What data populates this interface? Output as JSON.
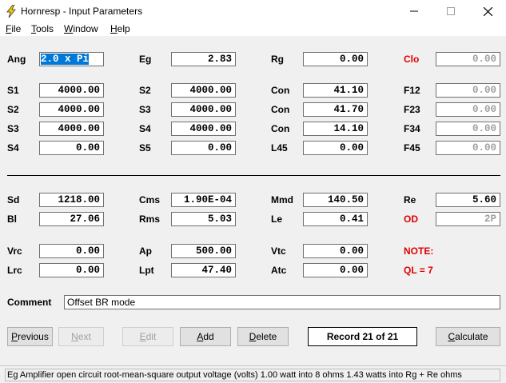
{
  "window": {
    "title": "Hornresp - Input Parameters"
  },
  "menu": [
    {
      "key": "F",
      "rest": "ile"
    },
    {
      "key": "T",
      "rest": "ools"
    },
    {
      "key": "W",
      "rest": "indow"
    },
    {
      "key": "H",
      "rest": "elp"
    }
  ],
  "params": {
    "Ang": {
      "label": "Ang",
      "value": "2.0 x Pi"
    },
    "Eg": {
      "label": "Eg",
      "value": "2.83"
    },
    "Rg": {
      "label": "Rg",
      "value": "0.00"
    },
    "Clo": {
      "label": "Clo",
      "value": "0.00"
    },
    "S1": {
      "label": "S1",
      "value": "4000.00"
    },
    "S2": {
      "label": "S2",
      "value": "4000.00"
    },
    "Con1": {
      "label": "Con",
      "value": "41.10"
    },
    "F12": {
      "label": "F12",
      "value": "0.00"
    },
    "S2b": {
      "label": "S2",
      "value": "4000.00"
    },
    "S3": {
      "label": "S3",
      "value": "4000.00"
    },
    "Con2": {
      "label": "Con",
      "value": "41.70"
    },
    "F23": {
      "label": "F23",
      "value": "0.00"
    },
    "S3b": {
      "label": "S3",
      "value": "4000.00"
    },
    "S4": {
      "label": "S4",
      "value": "4000.00"
    },
    "Con3": {
      "label": "Con",
      "value": "14.10"
    },
    "F34": {
      "label": "F34",
      "value": "0.00"
    },
    "S4b": {
      "label": "S4",
      "value": "0.00"
    },
    "S5": {
      "label": "S5",
      "value": "0.00"
    },
    "L45": {
      "label": "L45",
      "value": "0.00"
    },
    "F45": {
      "label": "F45",
      "value": "0.00"
    },
    "Sd": {
      "label": "Sd",
      "value": "1218.00"
    },
    "Cms": {
      "label": "Cms",
      "value": "1.90E-04"
    },
    "Mmd": {
      "label": "Mmd",
      "value": "140.50"
    },
    "Re": {
      "label": "Re",
      "value": "5.60"
    },
    "Bl": {
      "label": "Bl",
      "value": "27.06"
    },
    "Rms": {
      "label": "Rms",
      "value": "5.03"
    },
    "Le": {
      "label": "Le",
      "value": "0.41"
    },
    "OD": {
      "label": "OD",
      "value": "2P"
    },
    "Vrc": {
      "label": "Vrc",
      "value": "0.00"
    },
    "Ap": {
      "label": "Ap",
      "value": "500.00"
    },
    "Vtc": {
      "label": "Vtc",
      "value": "0.00"
    },
    "Lrc": {
      "label": "Lrc",
      "value": "0.00"
    },
    "Lpt": {
      "label": "Lpt",
      "value": "47.40"
    },
    "Atc": {
      "label": "Atc",
      "value": "0.00"
    }
  },
  "notes": {
    "note": "NOTE:",
    "ql": "QL = 7"
  },
  "comment": {
    "label": "Comment",
    "value": "Offset BR mode"
  },
  "buttons": {
    "previous": {
      "key": "P",
      "rest": "revious"
    },
    "next": {
      "key": "N",
      "rest": "ext"
    },
    "edit": {
      "key": "E",
      "rest": "dit"
    },
    "add": {
      "key": "A",
      "rest": "dd"
    },
    "delete": {
      "key": "D",
      "rest": "elete"
    },
    "calculate": {
      "key": "C",
      "rest": "alculate"
    }
  },
  "record": "Record 21 of 21",
  "status": "Eg  Amplifier open circuit root-mean-square output voltage  (volts)  1.00 watt into 8 ohms   1.43 watts into Rg + Re ohms",
  "colors": {
    "red_label": "#e00000",
    "selection": "#0078d7",
    "disabled_text": "#a0a0a0"
  }
}
